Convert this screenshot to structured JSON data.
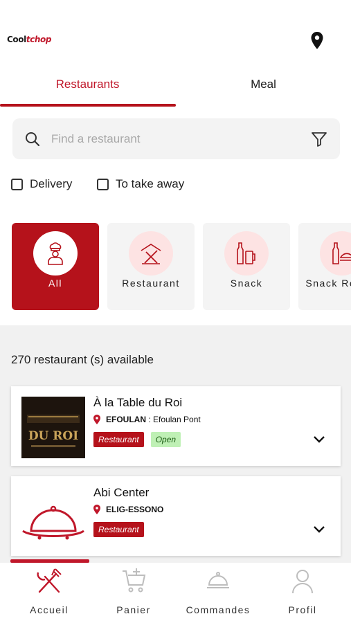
{
  "header": {
    "logo_part1": "Cool",
    "logo_part2": "tchop"
  },
  "tabs": [
    {
      "label": "Restaurants"
    },
    {
      "label": "Meal"
    }
  ],
  "search": {
    "placeholder": "Find a restaurant",
    "value": ""
  },
  "filters": [
    {
      "label": "Delivery"
    },
    {
      "label": "To take away"
    }
  ],
  "categories": [
    {
      "label": "All"
    },
    {
      "label": "Restaurant"
    },
    {
      "label": "Snack"
    },
    {
      "label": "Snack Restau"
    }
  ],
  "results": {
    "count_text": "270 restaurant (s) available"
  },
  "restaurants": [
    {
      "name": "À la Table du Roi",
      "area": "EFOULAN",
      "address": " : Efoulan Pont",
      "type": "Restaurant",
      "status": "Open",
      "logo_text": "DU ROI"
    },
    {
      "name": "Abi Center",
      "area": "ELIG-ESSONO",
      "address": "",
      "type": "Restaurant",
      "status": ""
    }
  ],
  "bottom_nav": [
    {
      "label": "Accueil"
    },
    {
      "label": "Panier"
    },
    {
      "label": "Commandes"
    },
    {
      "label": "Profil"
    }
  ],
  "colors": {
    "brand": "#b5121b",
    "open_bg": "#bff0b5",
    "card_bg": "#ffffff",
    "page_gray": "#f1f1f1"
  },
  "icons": [
    "map-pin-icon",
    "search-icon",
    "filter-icon",
    "checkbox-icon",
    "chef-icon",
    "cutlery-icon",
    "drinks-icon",
    "chevron-down-icon",
    "cart-icon",
    "cloche-icon",
    "profile-icon"
  ]
}
